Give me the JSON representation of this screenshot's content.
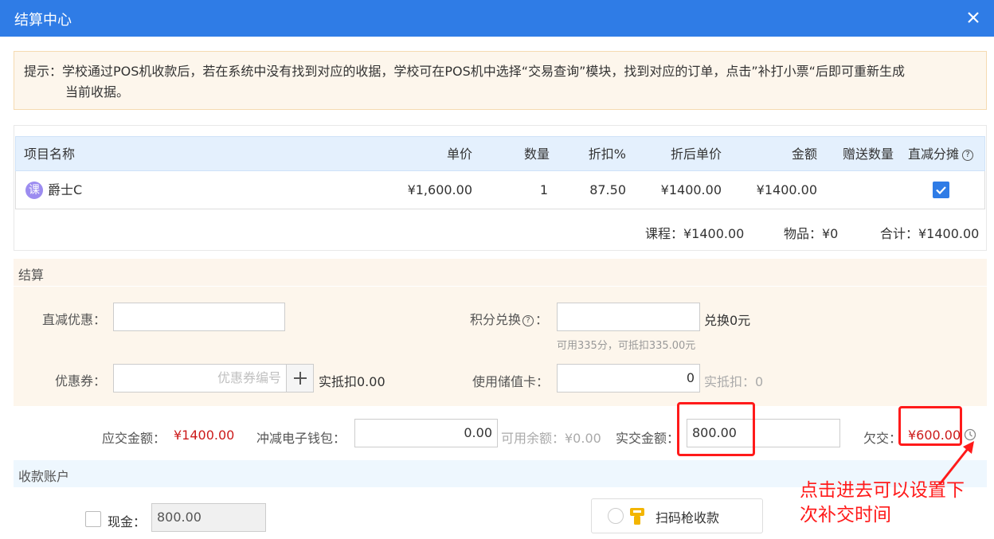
{
  "window": {
    "title": "结算中心"
  },
  "tip": {
    "line1": "提示：学校通过POS机收款后，若在系统中没有找到对应的收据，学校可在POS机中选择“交易查询”模块，找到对应的订单，点击”补打小票“后即可重新生成",
    "line2": "当前收据。"
  },
  "table": {
    "headers": {
      "name": "项目名称",
      "price": "单价",
      "qty": "数量",
      "discount": "折扣%",
      "disc_price": "折后单价",
      "amount": "金额",
      "gift_qty": "赠送数量",
      "direct_share": "直减分摊"
    },
    "rows": [
      {
        "badge": "课",
        "name": "爵士C",
        "price": "¥1,600.00",
        "qty": "1",
        "discount": "87.50",
        "disc_price": "¥1400.00",
        "amount": "¥1400.00",
        "gift_qty": "",
        "direct_share_checked": true
      }
    ],
    "totals": {
      "course": "课程：¥1400.00",
      "goods": "物品：¥0",
      "sum": "合计：¥1400.00"
    }
  },
  "settle": {
    "title": "结算",
    "direct_discount": {
      "label": "直减优惠：",
      "value": ""
    },
    "points": {
      "label": "积分兑换",
      "colon": "：",
      "value": "",
      "suffix": "兑换0元",
      "hint": "可用335分，可抵扣335.00元"
    },
    "coupon": {
      "label": "优惠券：",
      "placeholder": "优惠券编号",
      "suffix": "实抵扣0.00"
    },
    "stored_card": {
      "label": "使用储值卡：",
      "value": "0",
      "suffix": "实抵扣：0"
    }
  },
  "payment": {
    "due_label": "应交金额：",
    "due_value": "¥1400.00",
    "wallet_label": "冲减电子钱包：",
    "wallet_value": "0.00",
    "balance_label": "可用余额：¥0.00",
    "paid_label": "实交金额：",
    "paid_value": "800.00",
    "owed_label": "欠交：",
    "owed_value": "¥600.00"
  },
  "accounts": {
    "title": "收款账户",
    "cash_label": "现金：",
    "cash_value": "800.00",
    "scan_label": "扫码枪收款"
  },
  "annotation": {
    "line1": "点击进去可以设置下",
    "line2": "次补交时间"
  },
  "colors": {
    "accent": "#2f7ce6",
    "warn_red": "#cc1b1b",
    "annotation_red": "#ff1a1a"
  }
}
